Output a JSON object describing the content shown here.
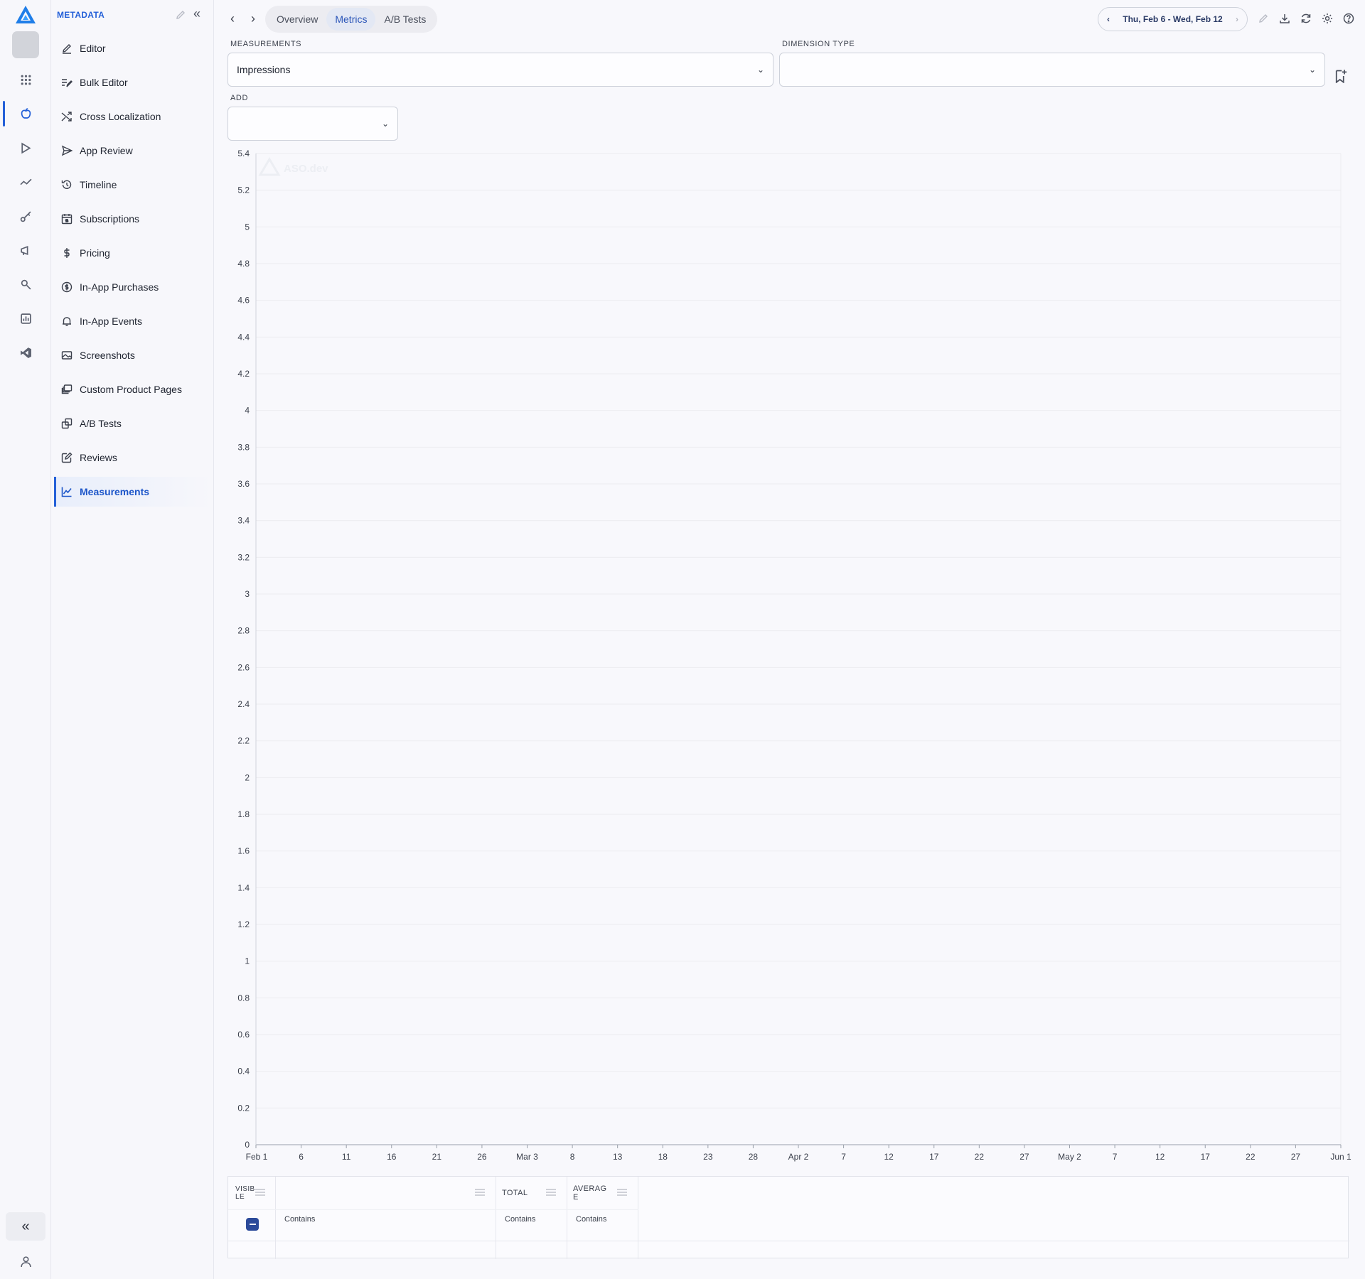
{
  "sidebar": {
    "heading": "METADATA",
    "items": [
      {
        "label": "Editor",
        "icon": "pencil-icon"
      },
      {
        "label": "Bulk Editor",
        "icon": "bulk-edit-icon"
      },
      {
        "label": "Cross Localization",
        "icon": "shuffle-icon"
      },
      {
        "label": "App Review",
        "icon": "send-icon"
      },
      {
        "label": "Timeline",
        "icon": "history-icon"
      },
      {
        "label": "Subscriptions",
        "icon": "calendar-dollar-icon"
      },
      {
        "label": "Pricing",
        "icon": "dollar-icon"
      },
      {
        "label": "In-App Purchases",
        "icon": "coin-icon"
      },
      {
        "label": "In-App Events",
        "icon": "bell-icon"
      },
      {
        "label": "Screenshots",
        "icon": "image-icon"
      },
      {
        "label": "Custom Product Pages",
        "icon": "stack-icon"
      },
      {
        "label": "A/B Tests",
        "icon": "ab-icon"
      },
      {
        "label": "Reviews",
        "icon": "review-icon"
      },
      {
        "label": "Measurements",
        "icon": "line-chart-icon",
        "active": true
      }
    ]
  },
  "header": {
    "tabs": [
      {
        "label": "Overview"
      },
      {
        "label": "Metrics",
        "active": true
      },
      {
        "label": "A/B Tests"
      }
    ],
    "date_range": "Thu, Feb 6 - Wed, Feb 12"
  },
  "filters": {
    "measurements_label": "MEASUREMENTS",
    "measurements_value": "Impressions",
    "dimension_label": "DIMENSION TYPE",
    "dimension_value": "",
    "add_label": "ADD",
    "add_value": ""
  },
  "chart_data": {
    "type": "line",
    "watermark": "ASO.dev",
    "ylim": [
      0,
      5.4
    ],
    "y_ticks": [
      "0",
      "0.2",
      "0.4",
      "0.6",
      "0.8",
      "1",
      "1.2",
      "1.4",
      "1.6",
      "1.8",
      "2",
      "2.2",
      "2.4",
      "2.6",
      "2.8",
      "3",
      "3.2",
      "3.4",
      "3.6",
      "3.8",
      "4",
      "4.2",
      "4.4",
      "4.6",
      "4.8",
      "5",
      "5.2",
      "5.4"
    ],
    "x_ticks": [
      "Feb 1",
      "6",
      "11",
      "16",
      "21",
      "26",
      "Mar 3",
      "8",
      "13",
      "18",
      "23",
      "28",
      "Apr 2",
      "7",
      "12",
      "17",
      "22",
      "27",
      "May 2",
      "7",
      "12",
      "17",
      "22",
      "27",
      "Jun 1"
    ],
    "series": []
  },
  "table": {
    "columns": [
      {
        "label": "VISIBLE"
      },
      {
        "label": ""
      },
      {
        "label": "TOTAL"
      },
      {
        "label": "AVERAGE"
      }
    ],
    "filter_text": "Contains"
  },
  "colors": {
    "accent": "#2460d8",
    "gridline": "#ececf0",
    "axis": "#9aa0ab"
  }
}
